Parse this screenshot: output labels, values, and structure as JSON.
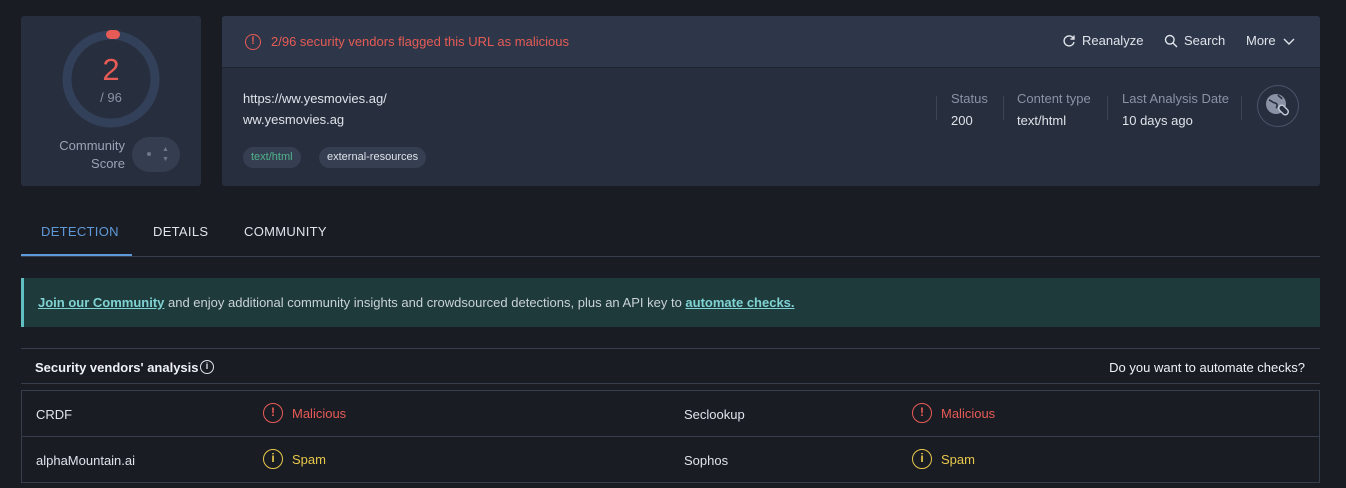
{
  "score": {
    "detections": "2",
    "total": "/ 96",
    "community_label_1": "Community",
    "community_label_2": "Score",
    "ring_fraction": 0.0208
  },
  "alert": {
    "text": "2/96 security vendors flagged this URL as malicious",
    "color": "#e65b55"
  },
  "actions": {
    "reanalyze": "Reanalyze",
    "search": "Search",
    "more": "More"
  },
  "url": {
    "full": "https://ww.yesmovies.ag/",
    "domain": "ww.yesmovies.ag"
  },
  "tags": [
    "text/html",
    "external-resources"
  ],
  "meta": [
    {
      "label": "Status",
      "value": "200"
    },
    {
      "label": "Content type",
      "value": "text/html"
    },
    {
      "label": "Last Analysis Date",
      "value": "10 days ago"
    }
  ],
  "tabs": [
    "DETECTION",
    "DETAILS",
    "COMMUNITY"
  ],
  "banner": {
    "link1": "Join our Community",
    "text": " and enjoy additional community insights and crowdsourced detections, plus an API key to ",
    "link2": "automate checks."
  },
  "vendors": {
    "title": "Security vendors' analysis",
    "cta": "Do you want to automate checks?",
    "rows": [
      {
        "left_name": "CRDF",
        "left_result": "Malicious",
        "right_name": "Seclookup",
        "right_result": "Malicious"
      },
      {
        "left_name": "alphaMountain.ai",
        "left_result": "Spam",
        "right_name": "Sophos",
        "right_result": "Spam"
      }
    ]
  },
  "icons": {
    "alert": "alert-circle-icon",
    "reanalyze": "refresh-icon",
    "search": "search-icon",
    "more": "chevron-down-icon",
    "globe": "globe-link-icon",
    "info": "info-icon"
  }
}
